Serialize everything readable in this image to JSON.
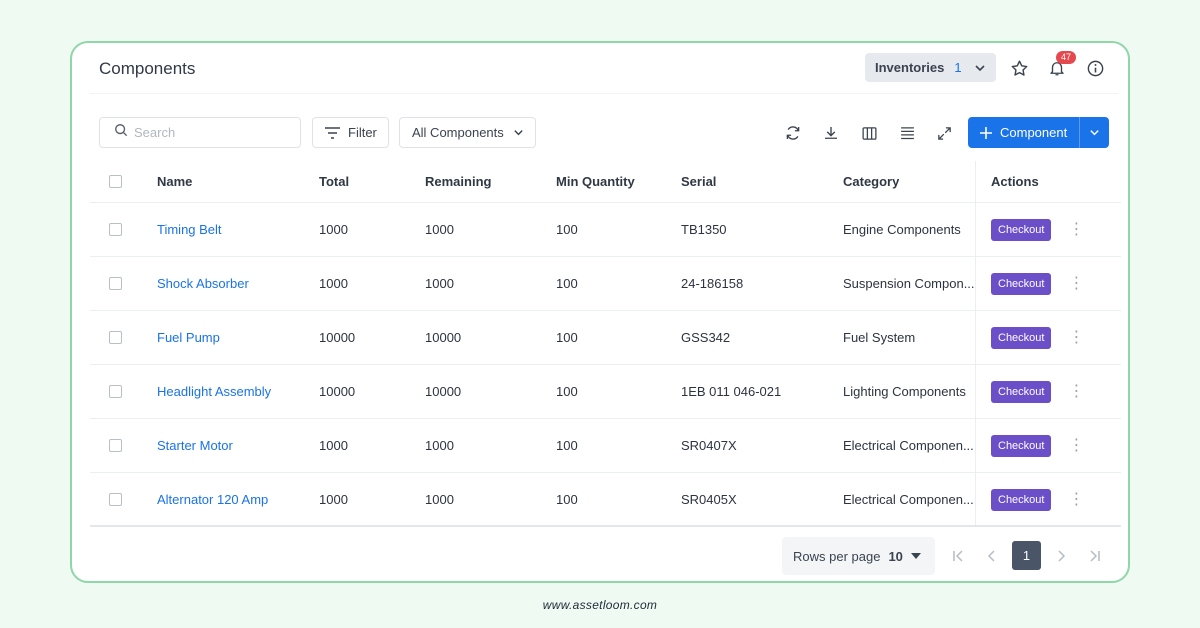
{
  "page": {
    "title": "Components"
  },
  "header": {
    "inventories_label": "Inventories",
    "inventories_count": "1",
    "notification_badge": "47"
  },
  "toolbar": {
    "search_placeholder": "Search",
    "filter_label": "Filter",
    "view_select": "All Components",
    "primary_label": "Component"
  },
  "table": {
    "columns": [
      "Name",
      "Total",
      "Remaining",
      "Min Quantity",
      "Serial",
      "Category",
      "Actions"
    ],
    "action_label": "Checkout",
    "rows": [
      {
        "name": "Timing Belt",
        "total": "1000",
        "remaining": "1000",
        "min": "100",
        "serial": "TB1350",
        "category": "Engine Components"
      },
      {
        "name": "Shock Absorber",
        "total": "1000",
        "remaining": "1000",
        "min": "100",
        "serial": "24-186158",
        "category": "Suspension Compon..."
      },
      {
        "name": "Fuel Pump",
        "total": "10000",
        "remaining": "10000",
        "min": "100",
        "serial": "GSS342",
        "category": "Fuel System"
      },
      {
        "name": "Headlight Assembly",
        "total": "10000",
        "remaining": "10000",
        "min": "100",
        "serial": "1EB 011 046-021",
        "category": "Lighting Components"
      },
      {
        "name": "Starter Motor",
        "total": "1000",
        "remaining": "1000",
        "min": "100",
        "serial": "SR0407X",
        "category": "Electrical Componen..."
      },
      {
        "name": "Alternator 120 Amp",
        "total": "1000",
        "remaining": "1000",
        "min": "100",
        "serial": "SR0405X",
        "category": "Electrical Componen..."
      }
    ]
  },
  "pagination": {
    "rows_per_page_label": "Rows per page",
    "rows_per_page_value": "10",
    "current_page": "1"
  },
  "footer": {
    "website": "www.assetloom.com"
  },
  "colors": {
    "primary": "#1a73e8",
    "checkout": "#6b4fc8",
    "badge": "#e5484d",
    "card_border": "#8fd6a8",
    "background": "#effaf3"
  }
}
